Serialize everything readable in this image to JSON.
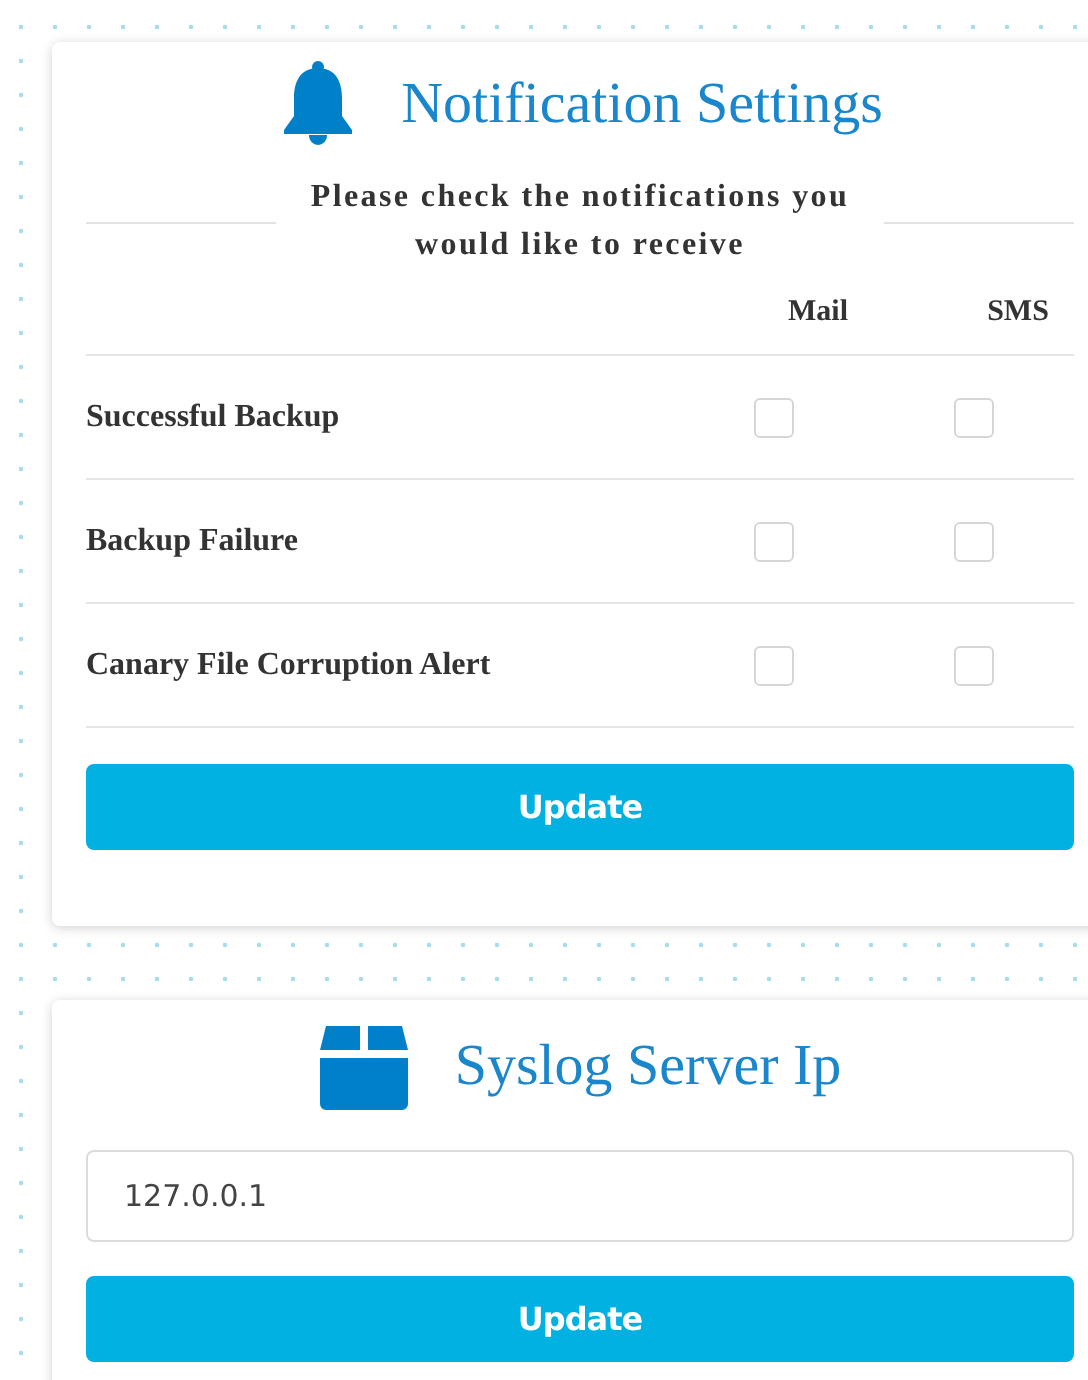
{
  "notification_card": {
    "title": "Notification Settings",
    "subtitle": "Please check the notifications you would like to receive",
    "columns": [
      "Mail",
      "SMS"
    ],
    "rows": [
      {
        "label": "Successful Backup",
        "mail": false,
        "sms": false
      },
      {
        "label": "Backup Failure",
        "mail": false,
        "sms": false
      },
      {
        "label": "Canary File Corruption Alert",
        "mail": false,
        "sms": false
      }
    ],
    "button": "Update"
  },
  "syslog_card": {
    "title": "Syslog Server Ip",
    "value": "127.0.0.1",
    "button": "Update"
  }
}
